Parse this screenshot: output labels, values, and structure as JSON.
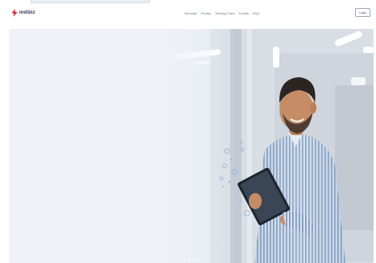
{
  "header": {
    "logo_text": "indibiz",
    "nav": [
      "Beranda",
      "Produk",
      "Tentang Kami",
      "Kontak",
      "FAQ"
    ],
    "login_label": "Login"
  },
  "hero": {
    "image": "person-with-tablet",
    "slide_count": 3,
    "active_slide": 1
  },
  "colors": {
    "brand_red": "#e4222b",
    "brand_navy": "#2b3350",
    "hero_bg": "#eef2f8"
  }
}
